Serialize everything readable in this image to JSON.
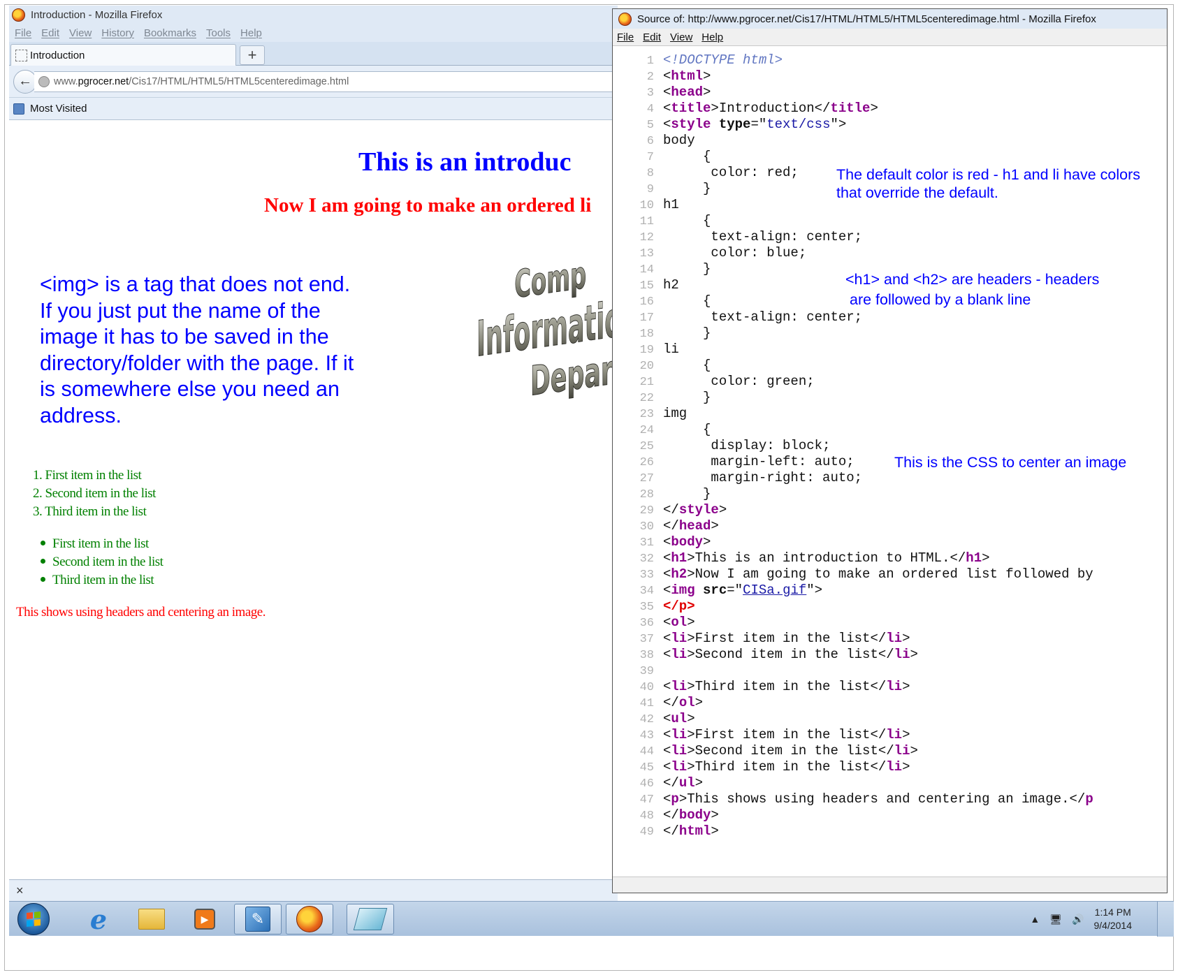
{
  "browser": {
    "window_title": "Introduction - Mozilla Firefox",
    "menu": [
      "File",
      "Edit",
      "View",
      "History",
      "Bookmarks",
      "Tools",
      "Help"
    ],
    "tab_label": "Introduction",
    "new_tab_label": "+",
    "url_prefix": "www.",
    "url_domain": "pgrocer.net",
    "url_path": "/Cis17/HTML/HTML5/HTML5centeredimage.html",
    "bookmark": "Most Visited",
    "findbar_close": "×"
  },
  "page": {
    "h1": "This is an introduc",
    "h2": "Now I am going to make an ordered li",
    "image_lines": [
      "Comp",
      "Informatio",
      "Depart"
    ],
    "ordered_list": [
      "1.  First item in the list",
      "2.  Second item in the list",
      "3.  Third item in the list"
    ],
    "unordered_list": [
      "First item in the list",
      "Second item in the list",
      "Third item in the list"
    ],
    "paragraph": "This shows using headers and centering an image."
  },
  "annotations": {
    "img_note": "<img> is a tag that does not end.  If you just put the name of the image it has to be saved in the directory/folder with the page.  If it is somewhere else you need an address.",
    "default_color_1": "The default color is red - h1 and li have colors",
    "default_color_2": "that override the default.",
    "headers_1": "<h1> and <h2> are headers - headers",
    "headers_2": "are followed by a blank line",
    "css_center": "This is the CSS to center an image"
  },
  "source_window": {
    "title": "Source of: http://www.pgrocer.net/Cis17/HTML/HTML5/HTML5centeredimage.html - Mozilla Firefox",
    "menu": [
      "File",
      "Edit",
      "View",
      "Help"
    ],
    "lines": [
      [
        "1",
        [
          [
            "dt",
            "<!DOCTYPE html>"
          ]
        ]
      ],
      [
        "2",
        [
          [
            "tx",
            "<"
          ],
          [
            "tg",
            "html"
          ],
          [
            "tx",
            ">"
          ]
        ]
      ],
      [
        "3",
        [
          [
            "tx",
            "<"
          ],
          [
            "tg",
            "head"
          ],
          [
            "tx",
            ">"
          ]
        ]
      ],
      [
        "4",
        [
          [
            "tx",
            "<"
          ],
          [
            "tg",
            "title"
          ],
          [
            "tx",
            ">Introduction</"
          ],
          [
            "tg",
            "title"
          ],
          [
            "tx",
            ">"
          ]
        ]
      ],
      [
        "5",
        [
          [
            "tx",
            "<"
          ],
          [
            "tg",
            "style"
          ],
          [
            "tx",
            " "
          ],
          [
            "at",
            "type"
          ],
          [
            "tx",
            "=\""
          ],
          [
            "vl",
            "text/css"
          ],
          [
            "tx",
            "\">"
          ]
        ]
      ],
      [
        "6",
        [
          [
            "tx",
            "body"
          ]
        ]
      ],
      [
        "7",
        [
          [
            "tx",
            "     {"
          ]
        ]
      ],
      [
        "8",
        [
          [
            "tx",
            "      color: red;"
          ]
        ]
      ],
      [
        "9",
        [
          [
            "tx",
            "     }"
          ]
        ]
      ],
      [
        "10",
        [
          [
            "tx",
            "h1"
          ]
        ]
      ],
      [
        "11",
        [
          [
            "tx",
            "     {"
          ]
        ]
      ],
      [
        "12",
        [
          [
            "tx",
            "      text-align: center;"
          ]
        ]
      ],
      [
        "13",
        [
          [
            "tx",
            "      color: blue;"
          ]
        ]
      ],
      [
        "14",
        [
          [
            "tx",
            "     }"
          ]
        ]
      ],
      [
        "15",
        [
          [
            "tx",
            "h2"
          ]
        ]
      ],
      [
        "16",
        [
          [
            "tx",
            "     {"
          ]
        ]
      ],
      [
        "17",
        [
          [
            "tx",
            "      text-align: center;"
          ]
        ]
      ],
      [
        "18",
        [
          [
            "tx",
            "     }"
          ]
        ]
      ],
      [
        "19",
        [
          [
            "tx",
            "li"
          ]
        ]
      ],
      [
        "20",
        [
          [
            "tx",
            "     {"
          ]
        ]
      ],
      [
        "21",
        [
          [
            "tx",
            "      color: green;"
          ]
        ]
      ],
      [
        "22",
        [
          [
            "tx",
            "     }"
          ]
        ]
      ],
      [
        "23",
        [
          [
            "tx",
            "img"
          ]
        ]
      ],
      [
        "24",
        [
          [
            "tx",
            "     {"
          ]
        ]
      ],
      [
        "25",
        [
          [
            "tx",
            "      display: block;"
          ]
        ]
      ],
      [
        "26",
        [
          [
            "tx",
            "      margin-left: auto;"
          ]
        ]
      ],
      [
        "27",
        [
          [
            "tx",
            "      margin-right: auto;"
          ]
        ]
      ],
      [
        "28",
        [
          [
            "tx",
            "     }"
          ]
        ]
      ],
      [
        "29",
        [
          [
            "tx",
            "</"
          ],
          [
            "tg",
            "style"
          ],
          [
            "tx",
            ">"
          ]
        ]
      ],
      [
        "30",
        [
          [
            "tx",
            "</"
          ],
          [
            "tg",
            "head"
          ],
          [
            "tx",
            ">"
          ]
        ]
      ],
      [
        "31",
        [
          [
            "tx",
            "<"
          ],
          [
            "tg",
            "body"
          ],
          [
            "tx",
            ">"
          ]
        ]
      ],
      [
        "32",
        [
          [
            "tx",
            "<"
          ],
          [
            "tg",
            "h1"
          ],
          [
            "tx",
            ">This is an introduction to HTML.</"
          ],
          [
            "tg",
            "h1"
          ],
          [
            "tx",
            ">"
          ]
        ]
      ],
      [
        "33",
        [
          [
            "tx",
            "<"
          ],
          [
            "tg",
            "h2"
          ],
          [
            "tx",
            ">Now I am going to make an ordered list followed by"
          ]
        ]
      ],
      [
        "34",
        [
          [
            "tx",
            "<"
          ],
          [
            "tg",
            "img"
          ],
          [
            "tx",
            " "
          ],
          [
            "at",
            "src"
          ],
          [
            "tx",
            "=\""
          ],
          [
            "lk",
            "CISa.gif"
          ],
          [
            "tx",
            "\">"
          ]
        ]
      ],
      [
        "35",
        [
          [
            "er",
            "</p>"
          ]
        ]
      ],
      [
        "36",
        [
          [
            "tx",
            "<"
          ],
          [
            "tg",
            "ol"
          ],
          [
            "tx",
            ">"
          ]
        ]
      ],
      [
        "37",
        [
          [
            "tx",
            "<"
          ],
          [
            "tg",
            "li"
          ],
          [
            "tx",
            ">First item in the list</"
          ],
          [
            "tg",
            "li"
          ],
          [
            "tx",
            ">"
          ]
        ]
      ],
      [
        "38",
        [
          [
            "tx",
            "<"
          ],
          [
            "tg",
            "li"
          ],
          [
            "tx",
            ">Second item in the list</"
          ],
          [
            "tg",
            "li"
          ],
          [
            "tx",
            ">"
          ]
        ]
      ],
      [
        "39",
        []
      ],
      [
        "40",
        [
          [
            "tx",
            "<"
          ],
          [
            "tg",
            "li"
          ],
          [
            "tx",
            ">Third item in the list</"
          ],
          [
            "tg",
            "li"
          ],
          [
            "tx",
            ">"
          ]
        ]
      ],
      [
        "41",
        [
          [
            "tx",
            "</"
          ],
          [
            "tg",
            "ol"
          ],
          [
            "tx",
            ">"
          ]
        ]
      ],
      [
        "42",
        [
          [
            "tx",
            "<"
          ],
          [
            "tg",
            "ul"
          ],
          [
            "tx",
            ">"
          ]
        ]
      ],
      [
        "43",
        [
          [
            "tx",
            "<"
          ],
          [
            "tg",
            "li"
          ],
          [
            "tx",
            ">First item in the list</"
          ],
          [
            "tg",
            "li"
          ],
          [
            "tx",
            ">"
          ]
        ]
      ],
      [
        "44",
        [
          [
            "tx",
            "<"
          ],
          [
            "tg",
            "li"
          ],
          [
            "tx",
            ">Second item in the list</"
          ],
          [
            "tg",
            "li"
          ],
          [
            "tx",
            ">"
          ]
        ]
      ],
      [
        "45",
        [
          [
            "tx",
            "<"
          ],
          [
            "tg",
            "li"
          ],
          [
            "tx",
            ">Third item in the list</"
          ],
          [
            "tg",
            "li"
          ],
          [
            "tx",
            ">"
          ]
        ]
      ],
      [
        "46",
        [
          [
            "tx",
            "</"
          ],
          [
            "tg",
            "ul"
          ],
          [
            "tx",
            ">"
          ]
        ]
      ],
      [
        "47",
        [
          [
            "tx",
            "<"
          ],
          [
            "tg",
            "p"
          ],
          [
            "tx",
            ">This shows using headers and centering an image.</"
          ],
          [
            "tg",
            "p"
          ]
        ]
      ],
      [
        "48",
        [
          [
            "tx",
            "</"
          ],
          [
            "tg",
            "body"
          ],
          [
            "tx",
            ">"
          ]
        ]
      ],
      [
        "49",
        [
          [
            "tx",
            "</"
          ],
          [
            "tg",
            "html"
          ],
          [
            "tx",
            ">"
          ]
        ]
      ]
    ]
  },
  "taskbar": {
    "apps": [
      "start-button",
      "internet-explorer-icon",
      "file-explorer-icon",
      "media-player-icon",
      "notepad-icon",
      "firefox-icon",
      "snipping-icon"
    ],
    "tray_arrow": "▲",
    "time": "1:14 PM",
    "date": "9/4/2014"
  }
}
